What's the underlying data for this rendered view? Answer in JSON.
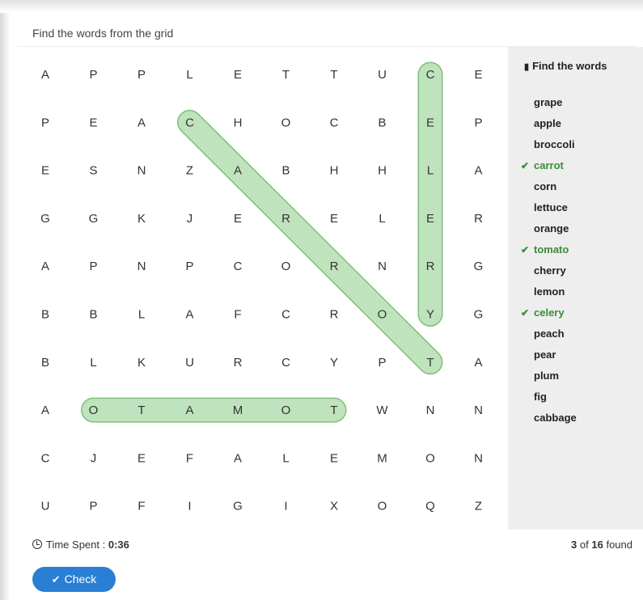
{
  "instructions": "Find the words from the grid",
  "grid": [
    [
      "A",
      "P",
      "P",
      "L",
      "E",
      "T",
      "T",
      "U",
      "C",
      "E"
    ],
    [
      "P",
      "E",
      "A",
      "C",
      "H",
      "O",
      "C",
      "B",
      "E",
      "P"
    ],
    [
      "E",
      "S",
      "N",
      "Z",
      "A",
      "B",
      "H",
      "H",
      "L",
      "A"
    ],
    [
      "G",
      "G",
      "K",
      "J",
      "E",
      "R",
      "E",
      "L",
      "E",
      "R"
    ],
    [
      "A",
      "P",
      "N",
      "P",
      "C",
      "O",
      "R",
      "N",
      "R",
      "G"
    ],
    [
      "B",
      "B",
      "L",
      "A",
      "F",
      "C",
      "R",
      "O",
      "Y",
      "G"
    ],
    [
      "B",
      "L",
      "K",
      "U",
      "R",
      "C",
      "Y",
      "P",
      "T",
      "A"
    ],
    [
      "A",
      "O",
      "T",
      "A",
      "M",
      "O",
      "T",
      "W",
      "N",
      "N"
    ],
    [
      "C",
      "J",
      "E",
      "F",
      "A",
      "L",
      "E",
      "M",
      "O",
      "N"
    ],
    [
      "U",
      "P",
      "F",
      "I",
      "G",
      "I",
      "X",
      "O",
      "Q",
      "Z"
    ]
  ],
  "found_words": [
    {
      "word": "celery",
      "start": [
        0,
        8
      ],
      "end": [
        5,
        8
      ]
    },
    {
      "word": "carrot",
      "start": [
        1,
        3
      ],
      "end": [
        6,
        8
      ]
    },
    {
      "word": "tomato",
      "start": [
        7,
        6
      ],
      "end": [
        7,
        1
      ]
    }
  ],
  "colors": {
    "highlight_fill": "#bfe3bd",
    "highlight_stroke": "#7fbf7b",
    "letter": "#333333",
    "found_word": "#3a8a3a",
    "button": "#2a7fd4",
    "sidebar_bg": "#eeeeee"
  },
  "sidebar": {
    "title": "Find the words",
    "icon": "book-icon",
    "words": [
      {
        "label": "grape",
        "found": false
      },
      {
        "label": "apple",
        "found": false
      },
      {
        "label": "broccoli",
        "found": false
      },
      {
        "label": "carrot",
        "found": true
      },
      {
        "label": "corn",
        "found": false
      },
      {
        "label": "lettuce",
        "found": false
      },
      {
        "label": "orange",
        "found": false
      },
      {
        "label": "tomato",
        "found": true
      },
      {
        "label": "cherry",
        "found": false
      },
      {
        "label": "lemon",
        "found": false
      },
      {
        "label": "celery",
        "found": true
      },
      {
        "label": "peach",
        "found": false
      },
      {
        "label": "pear",
        "found": false
      },
      {
        "label": "plum",
        "found": false
      },
      {
        "label": "fig",
        "found": false
      },
      {
        "label": "cabbage",
        "found": false
      }
    ]
  },
  "footer": {
    "time_label": "Time Spent :",
    "time_value": "0:36",
    "found_count": "3",
    "of_label": "of",
    "total_count": "16",
    "found_label": "found"
  },
  "check_button": {
    "label": "Check",
    "icon": "checkmark-icon"
  }
}
